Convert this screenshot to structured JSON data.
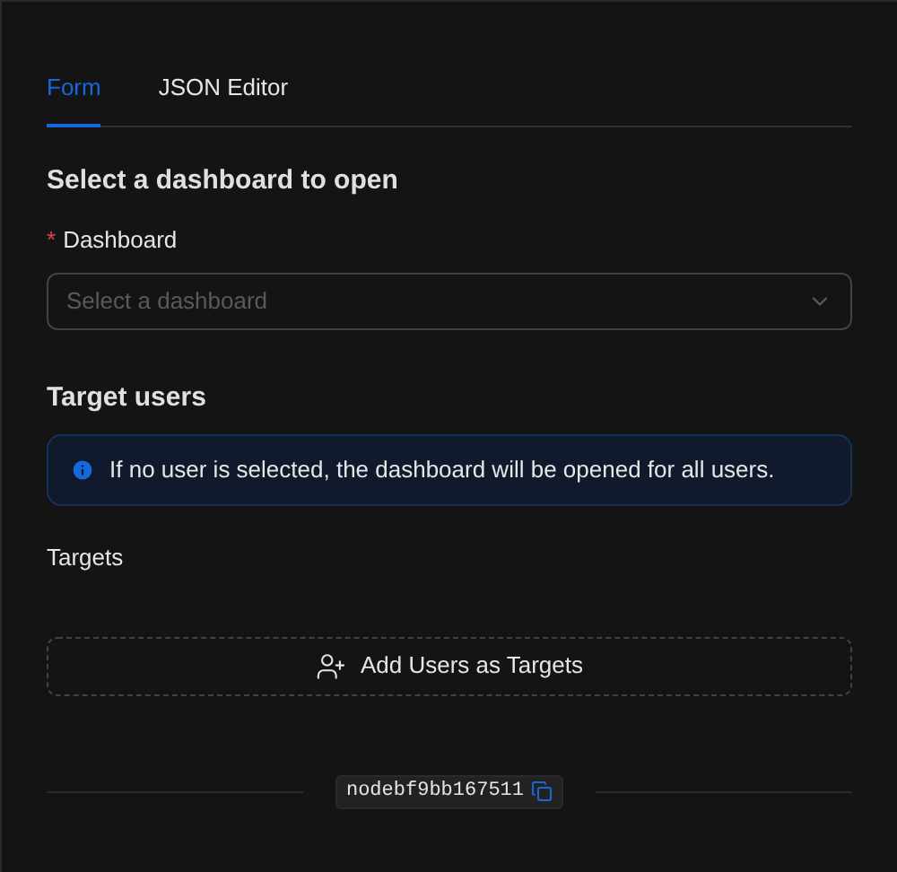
{
  "tabs": [
    {
      "label": "Form",
      "selected": true
    },
    {
      "label": "JSON Editor",
      "selected": false
    }
  ],
  "section_title": "Select a dashboard to open",
  "dashboard_field": {
    "required_mark": "*",
    "label": "Dashboard",
    "placeholder": "Select a dashboard"
  },
  "target_title": "Target users",
  "info_alert": {
    "text": "If no user is selected, the dashboard will be opened for all users."
  },
  "targets_label": "Targets",
  "add_button": {
    "label": "Add Users as Targets"
  },
  "node_id": "nodebf9bb167511"
}
